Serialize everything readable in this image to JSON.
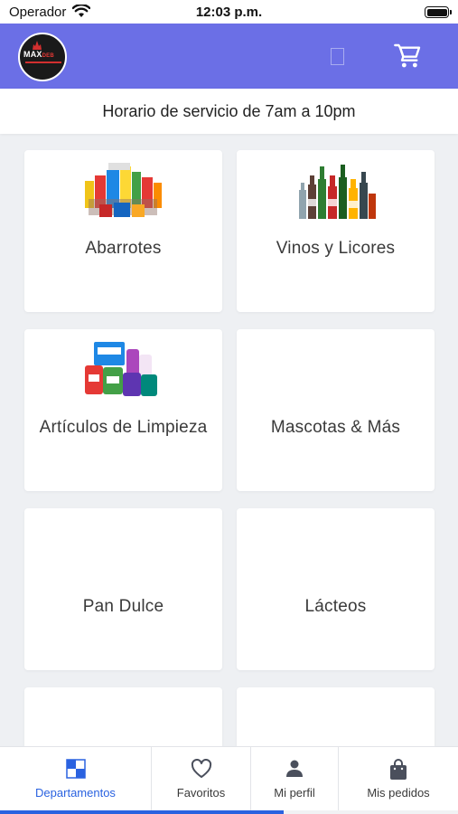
{
  "status_bar": {
    "carrier": "Operador",
    "time": "12:03 p.m."
  },
  "header": {
    "logo_text_main": "MAX",
    "logo_text_accent": "DEB",
    "cart_icon": "cart-icon"
  },
  "service_hours": "Horario de servicio de 7am a 10pm",
  "categories": [
    {
      "label": "Abarrotes",
      "image": "groceries-image"
    },
    {
      "label": "Vinos y Licores",
      "image": "liquor-bottles-image"
    },
    {
      "label": "Artículos de Limpieza",
      "image": "cleaning-products-image"
    },
    {
      "label": "Mascotas & Más",
      "image": ""
    },
    {
      "label": "Pan Dulce",
      "image": ""
    },
    {
      "label": "Lácteos",
      "image": ""
    },
    {
      "label": "",
      "image": ""
    },
    {
      "label": "",
      "image": ""
    }
  ],
  "bottom_nav": {
    "items": [
      {
        "label": "Departamentos",
        "icon": "grid-icon",
        "active": true
      },
      {
        "label": "Favoritos",
        "icon": "heart-icon",
        "active": false
      },
      {
        "label": "Mi perfil",
        "icon": "person-icon",
        "active": false
      },
      {
        "label": "Mis pedidos",
        "icon": "shopping-bag-icon",
        "active": false
      }
    ],
    "scroll_progress": 0.62
  },
  "colors": {
    "header": "#6b6fe6",
    "active": "#2a62e0",
    "background": "#eef0f3"
  }
}
